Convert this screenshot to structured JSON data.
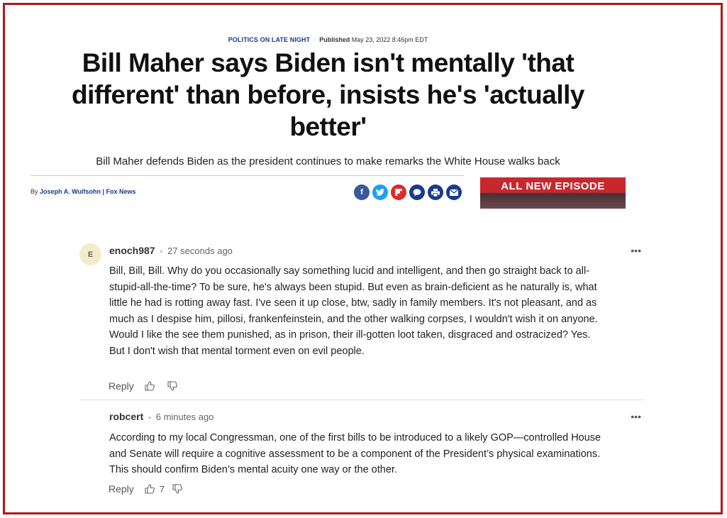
{
  "article": {
    "category": "POLITICS ON LATE NIGHT",
    "published_label": "Published",
    "published_date": "May 23, 2022 8:46pm EDT",
    "headline": "Bill Maher says Biden isn't mentally 'that different' than before, insists he's 'actually better'",
    "subheadline": "Bill Maher defends Biden as the president continues to make remarks the White House walks back",
    "byline_prefix": "By",
    "author": "Joseph A. Wulfsohn | Fox News",
    "share_icons": [
      "facebook-icon",
      "twitter-icon",
      "flipboard-icon",
      "comment-icon",
      "print-icon",
      "email-icon"
    ],
    "ad_text": "ALL NEW EPISODE"
  },
  "comments": [
    {
      "avatar_letter": "E",
      "username": "enoch987",
      "time": "27 seconds ago",
      "body": "Bill, Bill, Bill.  Why do you occasionally say something lucid and intelligent, and then go straight back to all-stupid-all-the-time?  To be sure, he's always been stupid.  But even as brain-deficient as he naturally is, what little he had is rotting away fast.  I've seen it up close, btw, sadly in family members.  It's not pleasant, and as much as I despise him, pillosi, frankenfeinstein, and the other walking corpses, I wouldn't wish it on anyone.  Would I like the see them punished, as in prison, their ill-gotten loot taken, disgraced and ostracized?  Yes.  But I don't wish that mental torment even on evil people.",
      "reply_label": "Reply",
      "likes": ""
    },
    {
      "avatar_letter": "",
      "username": "robcert",
      "time": "6 minutes ago",
      "body": "According to my local Congressman, one of the first bills to be introduced to a likely GOP—controlled House and Senate will require a cognitive assessment to be a component of the President’s physical examinations.  This should confirm Biden’s mental acuity one way or the other.",
      "reply_label": "Reply",
      "likes": "7"
    }
  ],
  "colors": {
    "frame": "#b01818",
    "facebook": "#3b5998",
    "twitter": "#1da1f2",
    "flipboard": "#e12828",
    "comment": "#1a3a8f",
    "print": "#1a3a8f",
    "email": "#1a3a8f"
  }
}
